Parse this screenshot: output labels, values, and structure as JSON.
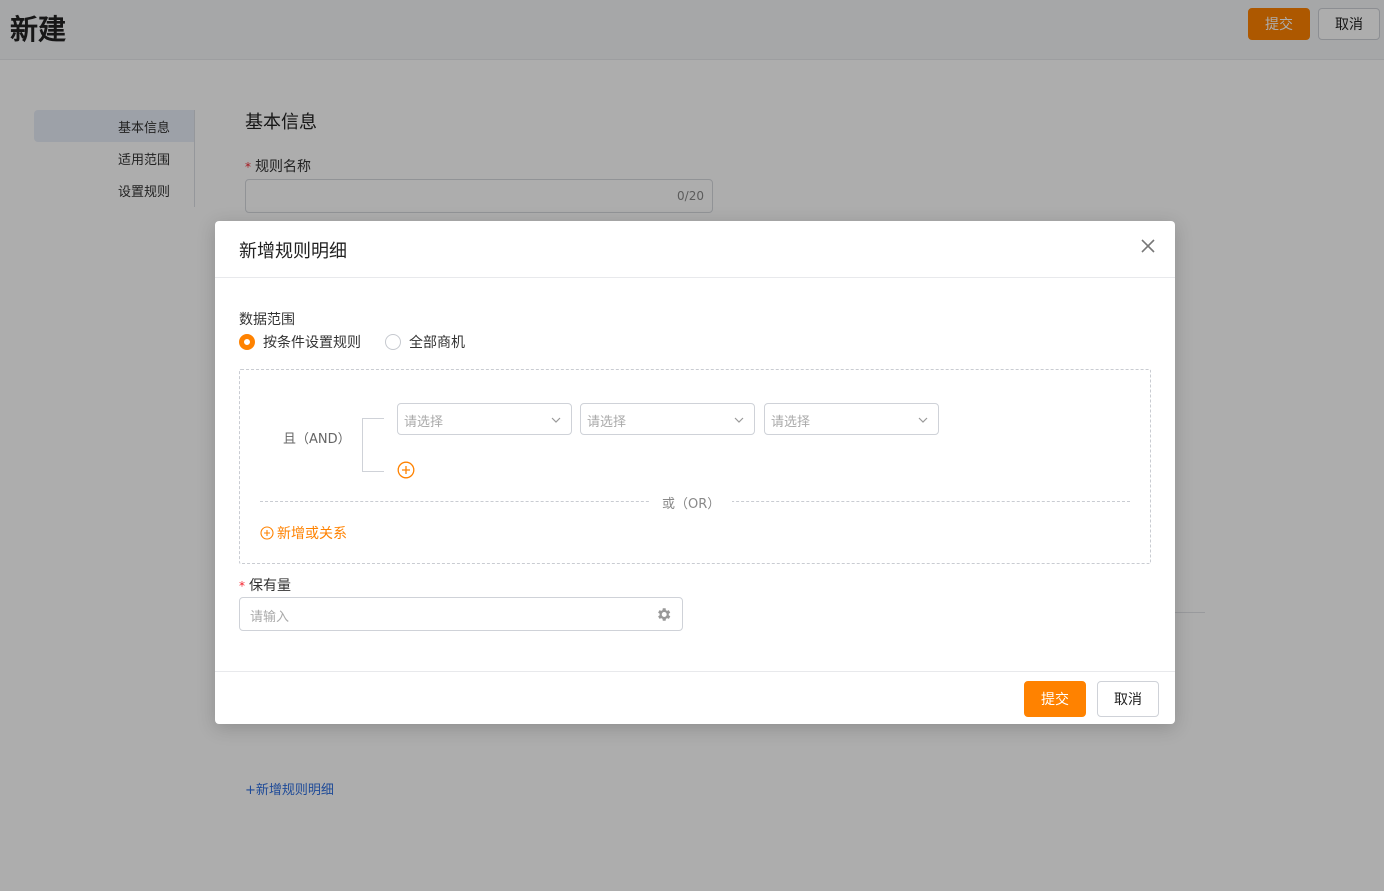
{
  "header": {
    "title": "新建",
    "submit_label": "提交",
    "cancel_label": "取消"
  },
  "sidenav": {
    "items": [
      {
        "label": "基本信息",
        "active": true
      },
      {
        "label": "适用范围",
        "active": false
      },
      {
        "label": "设置规则",
        "active": false
      }
    ]
  },
  "form": {
    "section_title": "基本信息",
    "rule_name_label": "规则名称",
    "rule_name_counter": "0/20",
    "add_rule_detail_link": "+新增规则明细"
  },
  "modal": {
    "title": "新增规则明细",
    "data_scope_label": "数据范围",
    "radio_options": [
      {
        "label": "按条件设置规则",
        "checked": true
      },
      {
        "label": "全部商机",
        "checked": false
      }
    ],
    "and_label": "且（AND）",
    "selects": [
      {
        "placeholder": "请选择"
      },
      {
        "placeholder": "请选择"
      },
      {
        "placeholder": "请选择"
      }
    ],
    "or_label": "或（OR）",
    "add_or_label": "新增或关系",
    "keep_label": "保有量",
    "keep_placeholder": "请输入",
    "submit_label": "提交",
    "cancel_label": "取消"
  },
  "colors": {
    "accent": "#ff8200",
    "link": "#2f6fe0",
    "required": "#f5222d"
  }
}
